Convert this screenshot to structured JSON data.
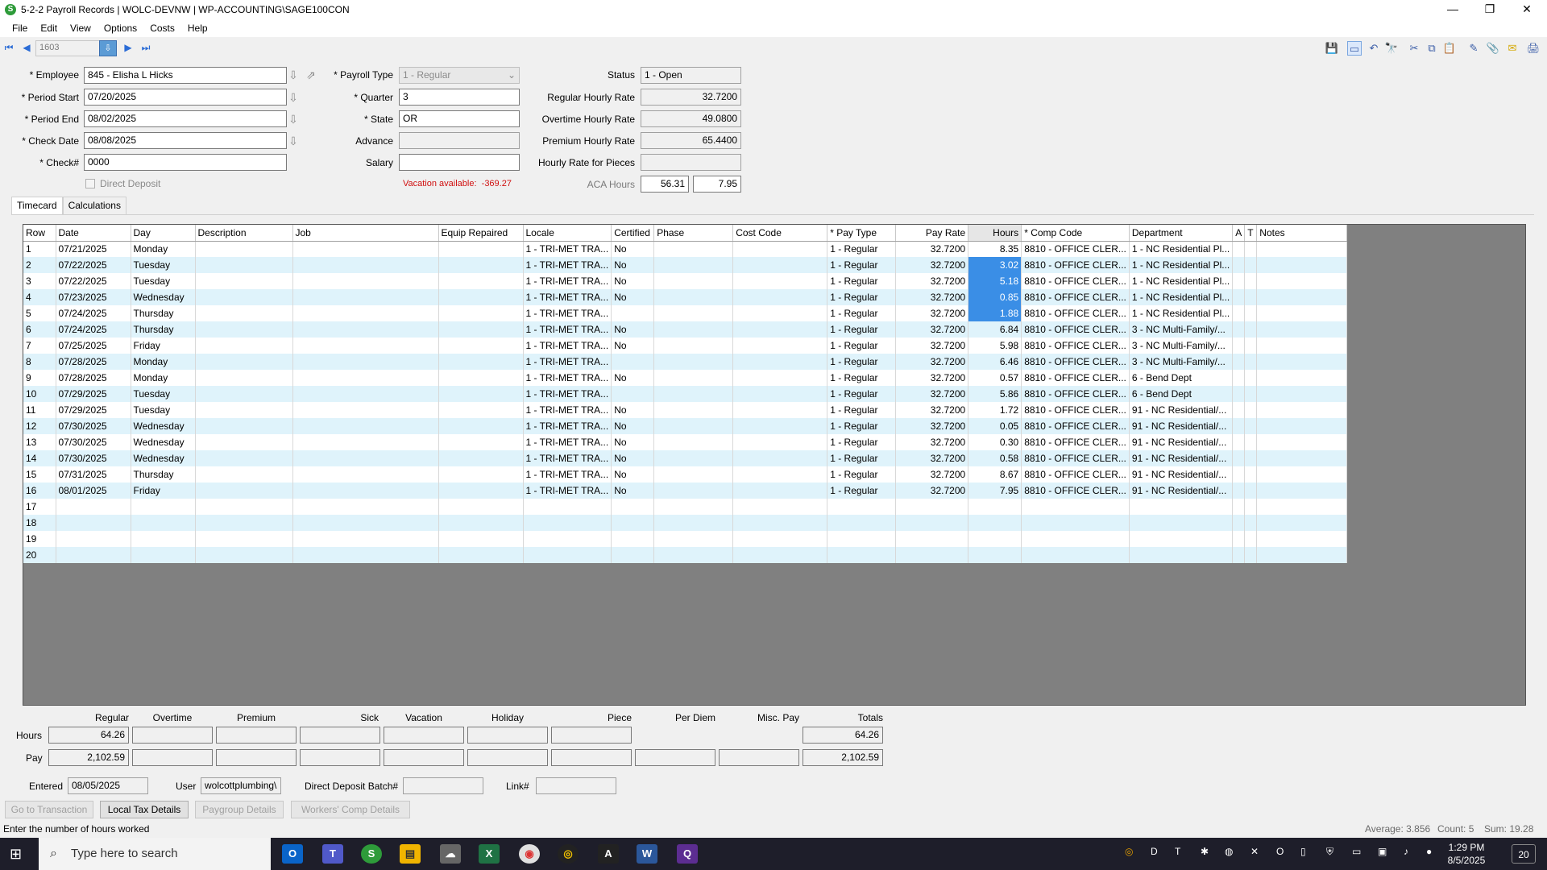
{
  "window": {
    "title": "5-2-2 Payroll Records | WOLC-DEVNW | WP-ACCOUNTING\\SAGE100CON",
    "app_icon_letter": "S",
    "minimize_glyph": "—",
    "maximize_glyph": "❐",
    "close_glyph": "✕"
  },
  "menu": [
    "File",
    "Edit",
    "View",
    "Options",
    "Costs",
    "Help"
  ],
  "nav": {
    "record": "1603"
  },
  "form": {
    "employee_label": "* Employee",
    "employee": "845 - Elisha L Hicks",
    "period_start_label": "* Period Start",
    "period_start": "07/20/2025",
    "period_end_label": "* Period End",
    "period_end": "08/02/2025",
    "check_date_label": "* Check Date",
    "check_date": "08/08/2025",
    "check_no_label": "* Check#",
    "check_no": "0000",
    "direct_deposit_label": "Direct Deposit",
    "payroll_type_label": "* Payroll Type",
    "payroll_type": "1 - Regular",
    "quarter_label": "* Quarter",
    "quarter": "3",
    "state_label": "* State",
    "state": "OR",
    "advance_label": "Advance",
    "advance": "",
    "salary_label": "Salary",
    "salary": "",
    "vacation_available_label": "Vacation available:",
    "vacation_available": "-369.27",
    "status_label": "Status",
    "status": "1 - Open",
    "regular_rate_label": "Regular Hourly Rate",
    "regular_rate": "32.7200",
    "overtime_rate_label": "Overtime Hourly Rate",
    "overtime_rate": "49.0800",
    "premium_rate_label": "Premium Hourly Rate",
    "premium_rate": "65.4400",
    "pieces_rate_label": "Hourly Rate for Pieces",
    "pieces_rate": "",
    "aca_hours_label": "ACA Hours",
    "aca_hours_1": "56.31",
    "aca_hours_2": "7.95"
  },
  "tabs": [
    "Timecard",
    "Calculations"
  ],
  "grid": {
    "columns": [
      "Row",
      "Date",
      "Day",
      "Description",
      "Job",
      "Equip Repaired",
      "Locale",
      "Certified",
      "Phase",
      "Cost Code",
      "* Pay Type",
      "Pay Rate",
      "Hours",
      "* Comp Code",
      "Department",
      "A",
      "T",
      "Notes"
    ],
    "rows": [
      [
        "1",
        "07/21/2025",
        "Monday",
        "",
        "",
        "",
        "1 - TRI-MET TRA...",
        "No",
        "",
        "",
        "1 - Regular",
        "32.7200",
        "8.35",
        "8810 - OFFICE CLER...",
        "1 - NC Residential Pl...",
        "",
        "",
        ""
      ],
      [
        "2",
        "07/22/2025",
        "Tuesday",
        "",
        "",
        "",
        "1 - TRI-MET TRA...",
        "No",
        "",
        "",
        "1 - Regular",
        "32.7200",
        "3.02",
        "8810 - OFFICE CLER...",
        "1 - NC Residential Pl...",
        "",
        "",
        ""
      ],
      [
        "3",
        "07/22/2025",
        "Tuesday",
        "",
        "",
        "",
        "1 - TRI-MET TRA...",
        "No",
        "",
        "",
        "1 - Regular",
        "32.7200",
        "5.18",
        "8810 - OFFICE CLER...",
        "1 - NC Residential Pl...",
        "",
        "",
        ""
      ],
      [
        "4",
        "07/23/2025",
        "Wednesday",
        "",
        "",
        "",
        "1 - TRI-MET TRA...",
        "No",
        "",
        "",
        "1 - Regular",
        "32.7200",
        "0.85",
        "8810 - OFFICE CLER...",
        "1 - NC Residential Pl...",
        "",
        "",
        ""
      ],
      [
        "5",
        "07/24/2025",
        "Thursday",
        "",
        "",
        "",
        "1 - TRI-MET TRA...",
        "",
        "",
        "",
        "1 - Regular",
        "32.7200",
        "1.88",
        "8810 - OFFICE CLER...",
        "1 - NC Residential Pl...",
        "",
        "",
        ""
      ],
      [
        "6",
        "07/24/2025",
        "Thursday",
        "",
        "",
        "",
        "1 - TRI-MET TRA...",
        "No",
        "",
        "",
        "1 - Regular",
        "32.7200",
        "6.84",
        "8810 - OFFICE CLER...",
        "3 - NC Multi-Family/...",
        "",
        "",
        ""
      ],
      [
        "7",
        "07/25/2025",
        "Friday",
        "",
        "",
        "",
        "1 - TRI-MET TRA...",
        "No",
        "",
        "",
        "1 - Regular",
        "32.7200",
        "5.98",
        "8810 - OFFICE CLER...",
        "3 - NC Multi-Family/...",
        "",
        "",
        ""
      ],
      [
        "8",
        "07/28/2025",
        "Monday",
        "",
        "",
        "",
        "1 - TRI-MET TRA...",
        "",
        "",
        "",
        "1 - Regular",
        "32.7200",
        "6.46",
        "8810 - OFFICE CLER...",
        "3 - NC Multi-Family/...",
        "",
        "",
        ""
      ],
      [
        "9",
        "07/28/2025",
        "Monday",
        "",
        "",
        "",
        "1 - TRI-MET TRA...",
        "No",
        "",
        "",
        "1 - Regular",
        "32.7200",
        "0.57",
        "8810 - OFFICE CLER...",
        "6 - Bend Dept",
        "",
        "",
        ""
      ],
      [
        "10",
        "07/29/2025",
        "Tuesday",
        "",
        "",
        "",
        "1 - TRI-MET TRA...",
        "",
        "",
        "",
        "1 - Regular",
        "32.7200",
        "5.86",
        "8810 - OFFICE CLER...",
        "6 - Bend Dept",
        "",
        "",
        ""
      ],
      [
        "11",
        "07/29/2025",
        "Tuesday",
        "",
        "",
        "",
        "1 - TRI-MET TRA...",
        "No",
        "",
        "",
        "1 - Regular",
        "32.7200",
        "1.72",
        "8810 - OFFICE CLER...",
        "91 - NC Residential/...",
        "",
        "",
        ""
      ],
      [
        "12",
        "07/30/2025",
        "Wednesday",
        "",
        "",
        "",
        "1 - TRI-MET TRA...",
        "No",
        "",
        "",
        "1 - Regular",
        "32.7200",
        "0.05",
        "8810 - OFFICE CLER...",
        "91 - NC Residential/...",
        "",
        "",
        ""
      ],
      [
        "13",
        "07/30/2025",
        "Wednesday",
        "",
        "",
        "",
        "1 - TRI-MET TRA...",
        "No",
        "",
        "",
        "1 - Regular",
        "32.7200",
        "0.30",
        "8810 - OFFICE CLER...",
        "91 - NC Residential/...",
        "",
        "",
        ""
      ],
      [
        "14",
        "07/30/2025",
        "Wednesday",
        "",
        "",
        "",
        "1 - TRI-MET TRA...",
        "No",
        "",
        "",
        "1 - Regular",
        "32.7200",
        "0.58",
        "8810 - OFFICE CLER...",
        "91 - NC Residential/...",
        "",
        "",
        ""
      ],
      [
        "15",
        "07/31/2025",
        "Thursday",
        "",
        "",
        "",
        "1 - TRI-MET TRA...",
        "No",
        "",
        "",
        "1 - Regular",
        "32.7200",
        "8.67",
        "8810 - OFFICE CLER...",
        "91 - NC Residential/...",
        "",
        "",
        ""
      ],
      [
        "16",
        "08/01/2025",
        "Friday",
        "",
        "",
        "",
        "1 - TRI-MET TRA...",
        "No",
        "",
        "",
        "1 - Regular",
        "32.7200",
        "7.95",
        "8810 - OFFICE CLER...",
        "91 - NC Residential/...",
        "",
        "",
        ""
      ],
      [
        "17",
        "",
        "",
        "",
        "",
        "",
        "",
        "",
        "",
        "",
        "",
        "",
        "",
        "",
        "",
        "",
        "",
        ""
      ],
      [
        "18",
        "",
        "",
        "",
        "",
        "",
        "",
        "",
        "",
        "",
        "",
        "",
        "",
        "",
        "",
        "",
        "",
        ""
      ],
      [
        "19",
        "",
        "",
        "",
        "",
        "",
        "",
        "",
        "",
        "",
        "",
        "",
        "",
        "",
        "",
        "",
        "",
        ""
      ],
      [
        "20",
        "",
        "",
        "",
        "",
        "",
        "",
        "",
        "",
        "",
        "",
        "",
        "",
        "",
        "",
        "",
        "",
        ""
      ]
    ]
  },
  "summary": {
    "headers": [
      "Regular",
      "Overtime",
      "Premium",
      "Sick",
      "Vacation",
      "Holiday",
      "Piece",
      "Per Diem",
      "Misc. Pay",
      "Totals"
    ],
    "hours_label": "Hours",
    "pay_label": "Pay",
    "hours": [
      "64.26",
      "",
      "",
      "",
      "",
      "",
      "",
      "",
      "",
      "64.26"
    ],
    "pay": [
      "2,102.59",
      "",
      "",
      "",
      "",
      "",
      "",
      "",
      "",
      "2,102.59"
    ]
  },
  "footer": {
    "entered_label": "Entered",
    "entered": "08/05/2025",
    "user_label": "User",
    "user": "wolcottplumbing\\",
    "dd_batch_label": "Direct Deposit Batch#",
    "dd_batch": "",
    "link_label": "Link#",
    "link": "",
    "buttons": [
      "Go to Transaction",
      "Local Tax Details",
      "Paygroup Details",
      "Workers' Comp Details"
    ]
  },
  "status_bar": {
    "message": "Enter the number of hours worked",
    "average": "Average: 3.856",
    "count": "Count: 5",
    "sum": "Sum: 19.28"
  },
  "taskbar": {
    "search_placeholder": "Type here to search",
    "time": "1:29 PM",
    "date": "8/5/2025",
    "notifications": "20"
  }
}
